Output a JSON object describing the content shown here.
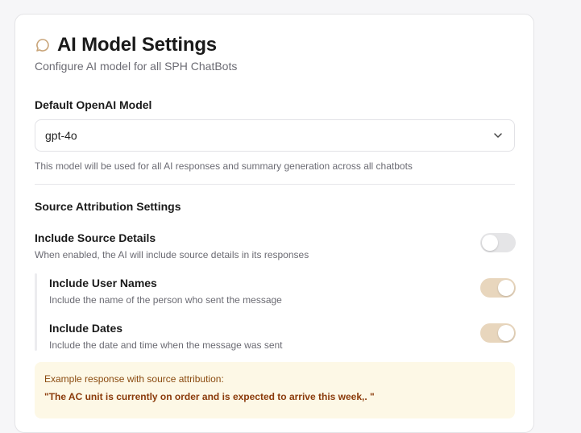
{
  "header": {
    "title": "AI Model Settings",
    "subtitle": "Configure AI model for all SPH ChatBots",
    "icon": "chat-bubble-icon"
  },
  "model": {
    "label": "Default OpenAI Model",
    "selected": "gpt-4o",
    "help": "This model will be used for all AI responses and summary generation across all chatbots"
  },
  "attribution": {
    "section_title": "Source Attribution Settings",
    "include_source": {
      "title": "Include Source Details",
      "desc": "When enabled, the AI will include source details in its responses",
      "enabled": false
    },
    "include_user_names": {
      "title": "Include User Names",
      "desc": "Include the name of the person who sent the message",
      "enabled": true
    },
    "include_dates": {
      "title": "Include Dates",
      "desc": "Include the date and time when the message was sent",
      "enabled": true
    },
    "example": {
      "label": "Example response with source attribution:",
      "quote": "\"The AC unit is currently on order and is expected to arrive this week,. \""
    }
  },
  "colors": {
    "accent": "#e8d6bd",
    "example_bg": "#fdf8e6",
    "example_text": "#8a4a0f"
  }
}
